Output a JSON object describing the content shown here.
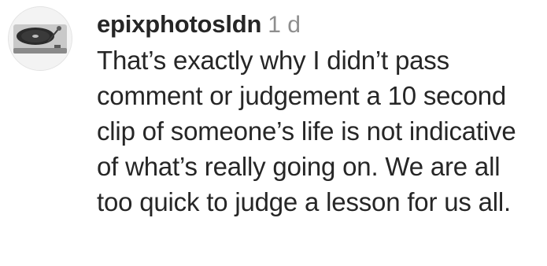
{
  "comment": {
    "avatar_icon": "turntable-icon",
    "username": "epixphotosldn",
    "timestamp": "1 d",
    "text": "That’s exactly why I didn’t pass comment or judgement a 10 second clip of someone’s life is not indicative of what’s really going on. We are all too quick to judge a lesson for us all."
  }
}
